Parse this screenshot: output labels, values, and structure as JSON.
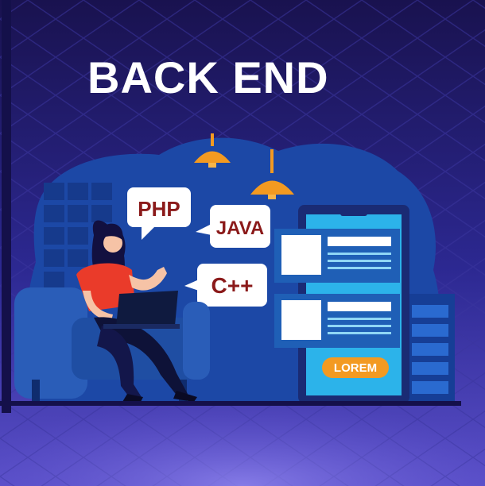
{
  "poster": {
    "title": "BACK END",
    "languages": [
      "PHP",
      "JAVA",
      "C++"
    ],
    "button_label": "LOREM"
  },
  "colors": {
    "background_top": "#1a1357",
    "background_bottom": "#4b3fb8",
    "blob": "#1e48a8",
    "lamp": "#f39a21",
    "phone_frame": "#1c2f7a",
    "phone_screen": "#2bb3ea",
    "card": "#1f5fb5",
    "shirt": "#ea3b2a",
    "button": "#f39a21"
  },
  "icons": [
    "lamp-icon",
    "laptop-icon",
    "chair-icon",
    "server-rack-icon"
  ]
}
